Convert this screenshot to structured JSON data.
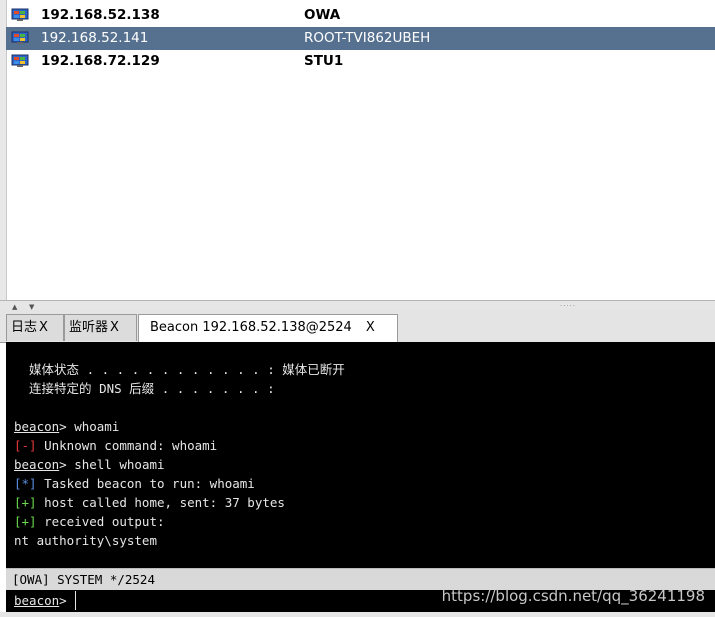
{
  "targets": [
    {
      "ip": "192.168.52.138",
      "name": "OWA",
      "selected": false
    },
    {
      "ip": "192.168.52.141",
      "name": "ROOT-TVI862UBEH",
      "selected": true
    },
    {
      "ip": "192.168.72.129",
      "name": "STU1",
      "selected": false
    }
  ],
  "tabs": [
    {
      "label": "日志",
      "close": "X"
    },
    {
      "label": "监听器",
      "close": "X"
    },
    {
      "label": "Beacon 192.168.52.138@2524",
      "close": "X"
    }
  ],
  "console": {
    "media_state": "  媒体状态 . . . . . . . . . . . . : 媒体已断开",
    "dns_suffix": "  连接特定的 DNS 后缀 . . . . . . . :",
    "prompt": "beacon",
    "cmd1": "> whoami",
    "err_tag": "[-]",
    "err_msg": " Unknown command: whoami",
    "cmd2": "> shell whoami",
    "task_tag": "[*]",
    "task_msg": " Tasked beacon to run: whoami",
    "sent_tag": "[+]",
    "sent_msg": " host called home, sent: 37 bytes",
    "recv_tag": "[+]",
    "recv_msg": " received output:",
    "output": "nt authority\\system"
  },
  "status": "[OWA] SYSTEM */2524",
  "input": {
    "prompt": "beacon",
    "prompt_suffix": ">",
    "value": ""
  },
  "watermark": "https://blog.csdn.net/qq_36241198",
  "colors": {
    "selected_row": "#56718f",
    "error": "#e33a3a",
    "info": "#5a8ee0",
    "success": "#6ad84e"
  },
  "icons": {
    "os": "windows-monitor-icon"
  }
}
